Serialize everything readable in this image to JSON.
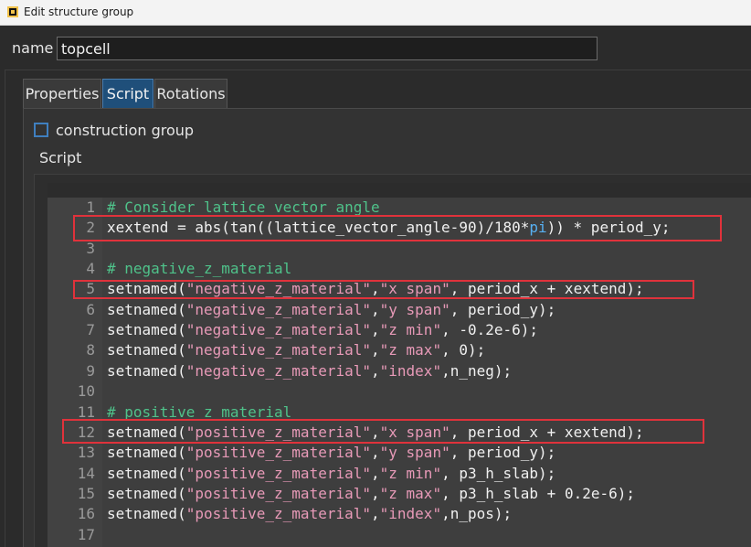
{
  "window": {
    "title": "Edit structure group"
  },
  "name_field": {
    "label": "name",
    "value": "topcell"
  },
  "tabs": [
    {
      "label": "Properties",
      "active": false
    },
    {
      "label": "Script",
      "active": true
    },
    {
      "label": "Rotations",
      "active": false
    }
  ],
  "construction_group": {
    "label": "construction group",
    "checked": false
  },
  "script_section": {
    "label": "Script"
  },
  "code_lines": [
    {
      "n": "1",
      "parts": [
        {
          "t": "comment",
          "v": "# Consider lattice vector angle"
        }
      ]
    },
    {
      "n": "2",
      "parts": [
        {
          "t": "plain",
          "v": "xextend = abs(tan((lattice_vector_angle-90)/180*"
        },
        {
          "t": "const",
          "v": "pi"
        },
        {
          "t": "plain",
          "v": ")) * period_y;"
        }
      ]
    },
    {
      "n": "3",
      "parts": []
    },
    {
      "n": "4",
      "parts": [
        {
          "t": "comment",
          "v": "# negative_z_material"
        }
      ]
    },
    {
      "n": "5",
      "parts": [
        {
          "t": "plain",
          "v": "setnamed("
        },
        {
          "t": "str",
          "v": "\"negative_z_material\""
        },
        {
          "t": "plain",
          "v": ","
        },
        {
          "t": "str",
          "v": "\"x span\""
        },
        {
          "t": "plain",
          "v": ", period_x + xextend);"
        }
      ]
    },
    {
      "n": "6",
      "parts": [
        {
          "t": "plain",
          "v": "setnamed("
        },
        {
          "t": "str",
          "v": "\"negative_z_material\""
        },
        {
          "t": "plain",
          "v": ","
        },
        {
          "t": "str",
          "v": "\"y span\""
        },
        {
          "t": "plain",
          "v": ", period_y);"
        }
      ]
    },
    {
      "n": "7",
      "parts": [
        {
          "t": "plain",
          "v": "setnamed("
        },
        {
          "t": "str",
          "v": "\"negative_z_material\""
        },
        {
          "t": "plain",
          "v": ","
        },
        {
          "t": "str",
          "v": "\"z min\""
        },
        {
          "t": "plain",
          "v": ", -0.2e-6);"
        }
      ]
    },
    {
      "n": "8",
      "parts": [
        {
          "t": "plain",
          "v": "setnamed("
        },
        {
          "t": "str",
          "v": "\"negative_z_material\""
        },
        {
          "t": "plain",
          "v": ","
        },
        {
          "t": "str",
          "v": "\"z max\""
        },
        {
          "t": "plain",
          "v": ", 0);"
        }
      ]
    },
    {
      "n": "9",
      "parts": [
        {
          "t": "plain",
          "v": "setnamed("
        },
        {
          "t": "str",
          "v": "\"negative_z_material\""
        },
        {
          "t": "plain",
          "v": ","
        },
        {
          "t": "str",
          "v": "\"index\""
        },
        {
          "t": "plain",
          "v": ",n_neg);"
        }
      ]
    },
    {
      "n": "10",
      "parts": []
    },
    {
      "n": "11",
      "parts": [
        {
          "t": "comment",
          "v": "# positive_z_material"
        }
      ]
    },
    {
      "n": "12",
      "parts": [
        {
          "t": "plain",
          "v": "setnamed("
        },
        {
          "t": "str",
          "v": "\"positive_z_material\""
        },
        {
          "t": "plain",
          "v": ","
        },
        {
          "t": "str",
          "v": "\"x span\""
        },
        {
          "t": "plain",
          "v": ", period_x + xextend);"
        }
      ]
    },
    {
      "n": "13",
      "parts": [
        {
          "t": "plain",
          "v": "setnamed("
        },
        {
          "t": "str",
          "v": "\"positive_z_material\""
        },
        {
          "t": "plain",
          "v": ","
        },
        {
          "t": "str",
          "v": "\"y span\""
        },
        {
          "t": "plain",
          "v": ", period_y);"
        }
      ]
    },
    {
      "n": "14",
      "parts": [
        {
          "t": "plain",
          "v": "setnamed("
        },
        {
          "t": "str",
          "v": "\"positive_z_material\""
        },
        {
          "t": "plain",
          "v": ","
        },
        {
          "t": "str",
          "v": "\"z min\""
        },
        {
          "t": "plain",
          "v": ", p3_h_slab);"
        }
      ]
    },
    {
      "n": "15",
      "parts": [
        {
          "t": "plain",
          "v": "setnamed("
        },
        {
          "t": "str",
          "v": "\"positive_z_material\""
        },
        {
          "t": "plain",
          "v": ","
        },
        {
          "t": "str",
          "v": "\"z max\""
        },
        {
          "t": "plain",
          "v": ", p3_h_slab + 0.2e-6);"
        }
      ]
    },
    {
      "n": "16",
      "parts": [
        {
          "t": "plain",
          "v": "setnamed("
        },
        {
          "t": "str",
          "v": "\"positive_z_material\""
        },
        {
          "t": "plain",
          "v": ","
        },
        {
          "t": "str",
          "v": "\"index\""
        },
        {
          "t": "plain",
          "v": ",n_pos);"
        }
      ]
    },
    {
      "n": "17",
      "parts": []
    }
  ],
  "highlighted_lines": [
    "2",
    "5",
    "12"
  ],
  "colors": {
    "comment": "#4fc28a",
    "string": "#e89ab8",
    "constant": "#57b0f2",
    "highlight_box": "#e0323b",
    "active_tab": "#1f4f7a"
  },
  "icons": {
    "app": "app-window-icon"
  }
}
